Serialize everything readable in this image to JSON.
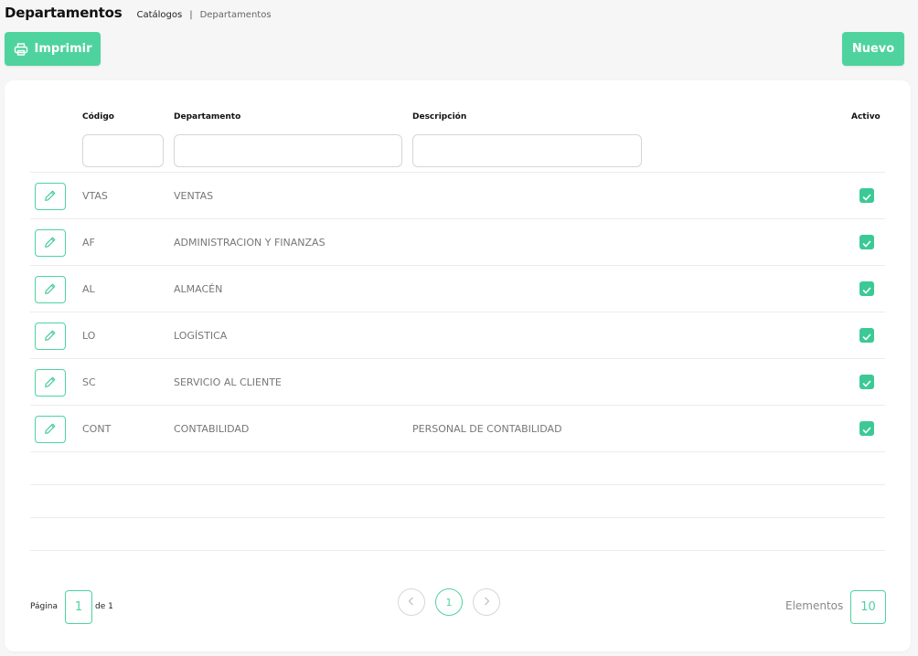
{
  "header": {
    "title": "Departamentos",
    "breadcrumb": {
      "parent": "Catálogos",
      "separator": "|",
      "current": "Departamentos"
    }
  },
  "toolbar": {
    "print_label": "Imprimir",
    "new_label": "Nuevo"
  },
  "table": {
    "columns": {
      "code": "Código",
      "department": "Departamento",
      "description": "Descripción",
      "active": "Activo"
    },
    "filters": {
      "code": "",
      "department": "",
      "description": ""
    },
    "rows": [
      {
        "code": "VTAS",
        "department": "VENTAS",
        "description": "",
        "active": true
      },
      {
        "code": "AF",
        "department": "ADMINISTRACION Y FINANZAS",
        "description": "",
        "active": true
      },
      {
        "code": "AL",
        "department": "ALMACÉN",
        "description": "",
        "active": true
      },
      {
        "code": "LO",
        "department": "LOGÍSTICA",
        "description": "",
        "active": true
      },
      {
        "code": "SC",
        "department": "SERVICIO AL CLIENTE",
        "description": "",
        "active": true
      },
      {
        "code": "CONT",
        "department": "CONTABILIDAD",
        "description": "PERSONAL DE CONTABILIDAD",
        "active": true
      }
    ]
  },
  "pagination": {
    "page_label": "Página",
    "page_value": "1",
    "of_label": "de 1",
    "current_page": "1",
    "prev_icon": "chevron-left-icon",
    "next_icon": "chevron-right-icon",
    "elements_label": "Elementos",
    "elements_value": "10"
  },
  "colors": {
    "accent": "#4ed39f",
    "checkbox": "#3cc996",
    "background": "#f6f6f6"
  }
}
